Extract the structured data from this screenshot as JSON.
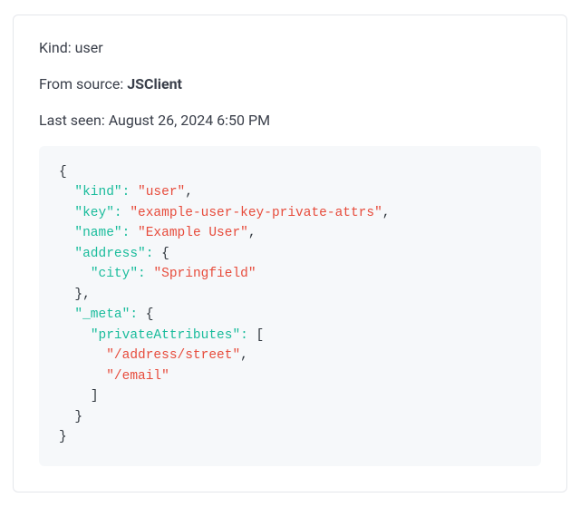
{
  "meta": {
    "kind_label": "Kind:",
    "kind_value": "user",
    "source_label": "From source:",
    "source_value": "JSClient",
    "last_seen_label": "Last seen:",
    "last_seen_value": "August 26, 2024 6:50 PM"
  },
  "json_payload": {
    "kind": "user",
    "key": "example-user-key-private-attrs",
    "name": "Example User",
    "address": {
      "city": "Springfield"
    },
    "_meta": {
      "privateAttributes": [
        "/address/street",
        "/email"
      ]
    }
  }
}
